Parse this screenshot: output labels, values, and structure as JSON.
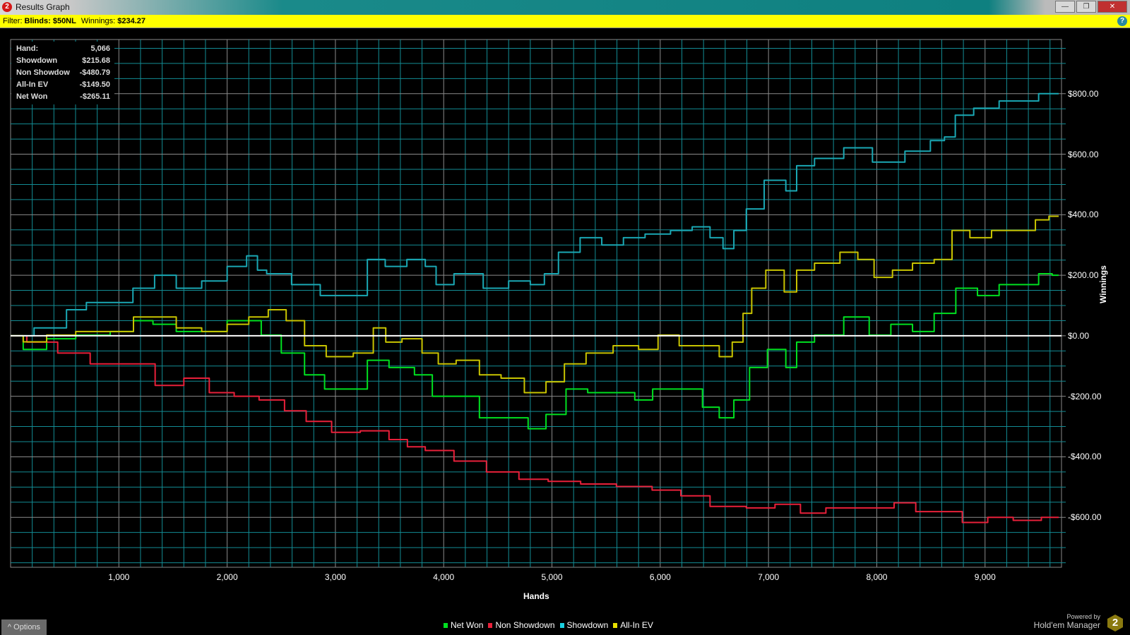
{
  "window": {
    "title": "Results Graph",
    "app_badge": "2",
    "minimize": "—",
    "maximize": "❐",
    "close": "✕"
  },
  "filter": {
    "prefix": "Filter:",
    "blinds_label": "Blinds: $50NL",
    "winnings_prefix": "Winnings:",
    "winnings_value": "$234.27",
    "help": "?"
  },
  "infobox": [
    {
      "label": "Hand:",
      "value": "5,066"
    },
    {
      "label": "Showdown",
      "value": "$215.68"
    },
    {
      "label": "Non Showdow",
      "value": "-$480.79"
    },
    {
      "label": "All-In EV",
      "value": "-$149.50"
    },
    {
      "label": "Net Won",
      "value": "-$265.11"
    }
  ],
  "footer": {
    "options": "^  Options",
    "powered_by": "Powered by",
    "product": "Hold'em Manager",
    "logo": "2"
  },
  "chart_data": {
    "type": "line",
    "xlabel": "Hands",
    "ylabel": "Winnings",
    "xlim": [
      0,
      9706
    ],
    "ylim": [
      -765,
      979
    ],
    "x_ticks": [
      1000,
      2000,
      3000,
      4000,
      5000,
      6000,
      7000,
      8000,
      9000
    ],
    "x_tick_labels": [
      "1,000",
      "2,000",
      "3,000",
      "4,000",
      "5,000",
      "6,000",
      "7,000",
      "8,000",
      "9,000"
    ],
    "y_ticks": [
      800,
      600,
      400,
      200,
      0,
      -200,
      -400,
      -600
    ],
    "y_tick_labels": [
      "$800.00",
      "$600.00",
      "$400.00",
      "$200.00",
      "$0.00",
      "-$200.00",
      "-$400.00",
      "-$600.00"
    ],
    "grid": true,
    "legend_position": "bottom-center",
    "series": [
      {
        "name": "Net Won",
        "color": "#00e020",
        "points": [
          [
            0,
            0
          ],
          [
            233,
            -45
          ],
          [
            433,
            -10
          ],
          [
            770,
            2
          ],
          [
            1070,
            14
          ],
          [
            1200,
            50
          ],
          [
            1430,
            38
          ],
          [
            1630,
            14
          ],
          [
            1900,
            14
          ],
          [
            2100,
            50
          ],
          [
            2260,
            50
          ],
          [
            2370,
            2
          ],
          [
            2630,
            -57
          ],
          [
            2800,
            -129
          ],
          [
            3000,
            -176
          ],
          [
            3230,
            -176
          ],
          [
            3360,
            -81
          ],
          [
            3630,
            -105
          ],
          [
            3830,
            -129
          ],
          [
            3960,
            -200
          ],
          [
            4230,
            -200
          ],
          [
            4430,
            -271
          ],
          [
            4700,
            -271
          ],
          [
            4860,
            -307
          ],
          [
            5030,
            -260
          ],
          [
            5230,
            -176
          ],
          [
            5430,
            -188
          ],
          [
            5700,
            -188
          ],
          [
            5830,
            -212
          ],
          [
            6030,
            -176
          ],
          [
            6290,
            -176
          ],
          [
            6490,
            -236
          ],
          [
            6600,
            -271
          ],
          [
            6760,
            -212
          ],
          [
            6890,
            -105
          ],
          [
            7090,
            -45
          ],
          [
            7230,
            -105
          ],
          [
            7290,
            -21
          ],
          [
            7560,
            2
          ],
          [
            7830,
            62
          ],
          [
            8030,
            2
          ],
          [
            8230,
            38
          ],
          [
            8430,
            14
          ],
          [
            8630,
            74
          ],
          [
            8830,
            157
          ],
          [
            9030,
            133
          ],
          [
            9230,
            169
          ],
          [
            9430,
            169
          ],
          [
            9560,
            205
          ],
          [
            9680,
            200
          ]
        ]
      },
      {
        "name": "Non Showdown",
        "color": "#e8203a",
        "points": [
          [
            0,
            0
          ],
          [
            300,
            -21
          ],
          [
            570,
            -57
          ],
          [
            900,
            -93
          ],
          [
            1170,
            -93
          ],
          [
            1500,
            -164
          ],
          [
            1700,
            -140
          ],
          [
            1970,
            -188
          ],
          [
            2160,
            -200
          ],
          [
            2430,
            -212
          ],
          [
            2630,
            -248
          ],
          [
            2830,
            -283
          ],
          [
            3100,
            -319
          ],
          [
            3360,
            -314
          ],
          [
            3630,
            -343
          ],
          [
            3700,
            -367
          ],
          [
            3960,
            -379
          ],
          [
            4230,
            -414
          ],
          [
            4560,
            -450
          ],
          [
            4830,
            -474
          ],
          [
            5100,
            -481
          ],
          [
            5430,
            -490
          ],
          [
            5760,
            -498
          ],
          [
            6090,
            -510
          ],
          [
            6290,
            -529
          ],
          [
            6630,
            -564
          ],
          [
            6960,
            -569
          ],
          [
            7160,
            -557
          ],
          [
            7430,
            -586
          ],
          [
            7630,
            -569
          ],
          [
            8030,
            -569
          ],
          [
            8290,
            -552
          ],
          [
            8430,
            -581
          ],
          [
            8690,
            -581
          ],
          [
            8890,
            -617
          ],
          [
            9160,
            -600
          ],
          [
            9360,
            -610
          ],
          [
            9680,
            -600
          ]
        ]
      },
      {
        "name": "Showdown",
        "color": "#1aa8b4",
        "points": [
          [
            0,
            0
          ],
          [
            433,
            26
          ],
          [
            600,
            86
          ],
          [
            800,
            110
          ],
          [
            1030,
            110
          ],
          [
            1230,
            157
          ],
          [
            1430,
            200
          ],
          [
            1630,
            157
          ],
          [
            1900,
            181
          ],
          [
            2100,
            229
          ],
          [
            2260,
            264
          ],
          [
            2300,
            217
          ],
          [
            2430,
            205
          ],
          [
            2760,
            169
          ],
          [
            2960,
            133
          ],
          [
            3230,
            133
          ],
          [
            3360,
            252
          ],
          [
            3560,
            229
          ],
          [
            3760,
            252
          ],
          [
            3900,
            229
          ],
          [
            3960,
            169
          ],
          [
            4230,
            205
          ],
          [
            4500,
            157
          ],
          [
            4700,
            181
          ],
          [
            4900,
            169
          ],
          [
            4960,
            205
          ],
          [
            5160,
            276
          ],
          [
            5360,
            324
          ],
          [
            5560,
            300
          ],
          [
            5760,
            324
          ],
          [
            5960,
            336
          ],
          [
            6230,
            348
          ],
          [
            6360,
            360
          ],
          [
            6560,
            324
          ],
          [
            6600,
            288
          ],
          [
            6760,
            348
          ],
          [
            6830,
            419
          ],
          [
            7090,
            514
          ],
          [
            7230,
            479
          ],
          [
            7290,
            562
          ],
          [
            7560,
            586
          ],
          [
            7830,
            621
          ],
          [
            8090,
            574
          ],
          [
            8430,
            610
          ],
          [
            8560,
            645
          ],
          [
            8690,
            657
          ],
          [
            8760,
            729
          ],
          [
            9030,
            752
          ],
          [
            9230,
            776
          ],
          [
            9430,
            776
          ],
          [
            9560,
            800
          ],
          [
            9680,
            800
          ]
        ]
      },
      {
        "name": "All-In EV",
        "color": "#c8c400",
        "points": [
          [
            0,
            0
          ],
          [
            233,
            -20
          ],
          [
            433,
            2
          ],
          [
            770,
            14
          ],
          [
            1070,
            14
          ],
          [
            1200,
            62
          ],
          [
            1430,
            62
          ],
          [
            1630,
            26
          ],
          [
            1900,
            14
          ],
          [
            2100,
            38
          ],
          [
            2300,
            62
          ],
          [
            2460,
            86
          ],
          [
            2630,
            50
          ],
          [
            2800,
            -33
          ],
          [
            3030,
            -69
          ],
          [
            3300,
            -57
          ],
          [
            3400,
            26
          ],
          [
            3530,
            -21
          ],
          [
            3700,
            -10
          ],
          [
            3900,
            -57
          ],
          [
            4000,
            -93
          ],
          [
            4230,
            -81
          ],
          [
            4430,
            -129
          ],
          [
            4630,
            -140
          ],
          [
            4860,
            -188
          ],
          [
            5030,
            -152
          ],
          [
            5200,
            -93
          ],
          [
            5430,
            -57
          ],
          [
            5700,
            -33
          ],
          [
            5900,
            -45
          ],
          [
            6060,
            2
          ],
          [
            6290,
            -33
          ],
          [
            6490,
            -33
          ],
          [
            6600,
            -69
          ],
          [
            6730,
            -21
          ],
          [
            6800,
            74
          ],
          [
            6890,
            157
          ],
          [
            7060,
            217
          ],
          [
            7230,
            145
          ],
          [
            7290,
            217
          ],
          [
            7560,
            240
          ],
          [
            7760,
            276
          ],
          [
            7890,
            252
          ],
          [
            8060,
            193
          ],
          [
            8230,
            217
          ],
          [
            8430,
            240
          ],
          [
            8630,
            252
          ],
          [
            8760,
            348
          ],
          [
            8960,
            324
          ],
          [
            9160,
            348
          ],
          [
            9430,
            348
          ],
          [
            9500,
            383
          ],
          [
            9680,
            395
          ]
        ]
      }
    ]
  }
}
